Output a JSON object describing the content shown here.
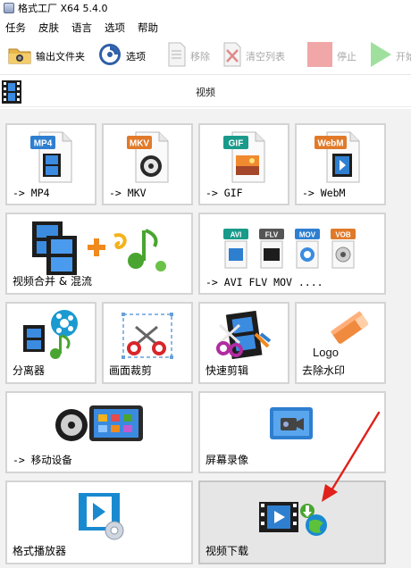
{
  "window": {
    "title": "格式工厂 X64 5.4.0"
  },
  "menu": {
    "items": [
      "任务",
      "皮肤",
      "语言",
      "选项",
      "帮助"
    ]
  },
  "toolbar": {
    "output_folder": "输出文件夹",
    "options": "选项",
    "remove": "移除",
    "clear_list": "清空列表",
    "stop": "停止",
    "start": "开始"
  },
  "section": {
    "title": "视频"
  },
  "tiles": {
    "mp4": {
      "label": "-> MP4",
      "badge": "MP4"
    },
    "mkv": {
      "label": "-> MKV",
      "badge": "MKV"
    },
    "gif": {
      "label": "-> GIF",
      "badge": "GIF"
    },
    "webm": {
      "label": "-> WebM",
      "badge": "WebM"
    },
    "merge": {
      "label": "视频合并 & 混流"
    },
    "multi": {
      "label": "-> AVI FLV MOV ....",
      "badges": [
        "AVI",
        "FLV",
        "MOV",
        "VOB"
      ]
    },
    "splitter": {
      "label": "分离器"
    },
    "crop": {
      "label": "画面裁剪"
    },
    "quickcut": {
      "label": "快速剪辑"
    },
    "watermark": {
      "label": "去除水印",
      "logo_text": "Logo"
    },
    "mobile": {
      "label": "-> 移动设备"
    },
    "screenrec": {
      "label": "屏幕录像"
    },
    "player": {
      "label": "格式播放器"
    },
    "download": {
      "label": "视频下载"
    }
  },
  "colors": {
    "mp4": "#2f7fd0",
    "mkv": "#e07a2a",
    "gif": "#1a9a8a",
    "webm": "#e07a2a",
    "arrow": "#e0201a",
    "selected_tile": "#e6e6e6"
  }
}
